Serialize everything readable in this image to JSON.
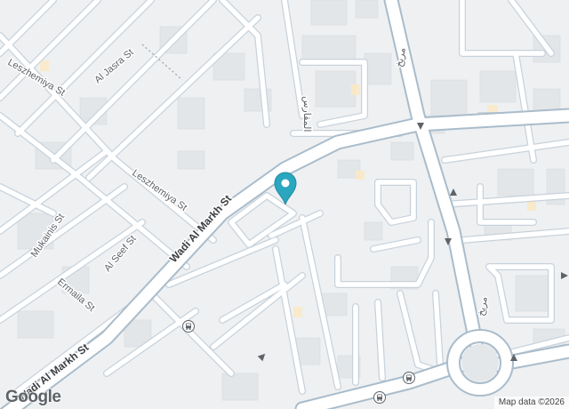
{
  "map": {
    "labels": {
      "al_jasra_st": "Al Jasra St",
      "leszhemiya_st_1": "Leszhemiya St",
      "leszhemiya_st_2": "Leszhemiya St",
      "wadi_al_markh_st_1": "Wadi Al Markh St",
      "wadi_al_markh_st_2": "Wadi Al Markh St",
      "mukainis_st": "Mukainis St",
      "al_seef_st": "Al Seef St",
      "ermaila_st": "Ermaila St",
      "al_maqaris": "المقارس",
      "mrikh_1": "مريخ",
      "mrikh_2": "مريخ"
    },
    "logo": "Google",
    "attribution": "Map data ©2026",
    "colors": {
      "background": "#eef0f2",
      "block": "#e4e7ea",
      "road": "#ffffff",
      "road_outline": "#c9d3dc",
      "major_road": "#ffffff",
      "major_outline": "#a9bccb",
      "pin": "#2aa7bf",
      "poi": "#fde7b0"
    },
    "icons": [
      "location-pin-icon",
      "bus-stop-icon",
      "one-way-arrow-icon"
    ]
  }
}
